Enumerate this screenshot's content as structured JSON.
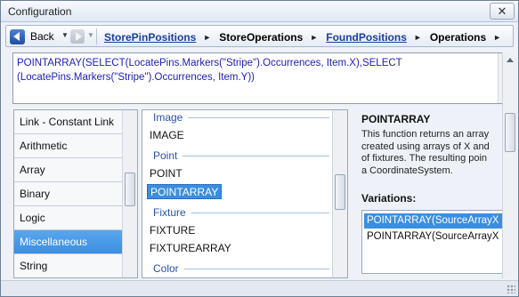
{
  "window": {
    "title": "Configuration",
    "close_glyph": "✕"
  },
  "nav": {
    "back_label": "Back",
    "dropdown_glyph": "▼",
    "crumb_sep_glyph": "►",
    "breadcrumbs": [
      {
        "label": "StorePinPositions",
        "link": true
      },
      {
        "label": "StoreOperations",
        "link": false
      },
      {
        "label": "FoundPositions",
        "link": true
      },
      {
        "label": "Operations",
        "link": false
      }
    ]
  },
  "formula": {
    "text": "POINTARRAY(SELECT(LocatePins.Markers(\"Stripe\").Occurrences, Item.X),SELECT (LocatePins.Markers(\"Stripe\").Occurrences, Item.Y))"
  },
  "categories": {
    "items": [
      "Link - Constant Link",
      "Arithmetic",
      "Array",
      "Binary",
      "Logic",
      "Miscellaneous",
      "String"
    ],
    "selected": "Miscellaneous"
  },
  "functions": {
    "groups": [
      {
        "header": "Image",
        "items": [
          "IMAGE"
        ]
      },
      {
        "header": "Point",
        "items": [
          "POINT",
          "POINTARRAY"
        ]
      },
      {
        "header": "Fixture",
        "items": [
          "FIXTURE",
          "FIXTUREARRAY"
        ]
      },
      {
        "header": "Color",
        "items": []
      }
    ],
    "selected": "POINTARRAY"
  },
  "help": {
    "title": "POINTARRAY",
    "description_lines": [
      "This function returns an array",
      "created using arrays of X and",
      "of fixtures. The resulting poin",
      "a CoordinateSystem."
    ],
    "variations_label": "Variations:",
    "variations": [
      "POINTARRAY(SourceArrayX",
      "POINTARRAY(SourceArrayX"
    ],
    "selected_variation": 0
  }
}
